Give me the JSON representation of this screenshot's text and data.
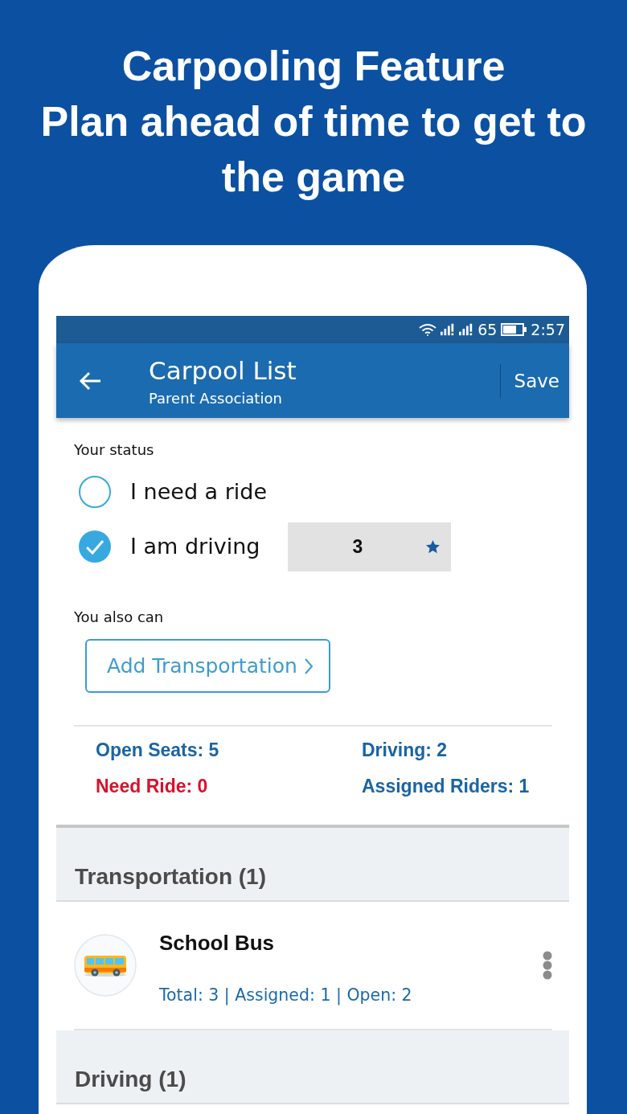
{
  "headline": {
    "title": "Carpooling Feature",
    "subtitle": "Plan ahead of time to get to the game"
  },
  "status_bar": {
    "battery": "65",
    "time": "2:57"
  },
  "app_bar": {
    "title": "Carpool List",
    "subtitle": "Parent Association",
    "action": "Save"
  },
  "your_status": {
    "label": "Your status",
    "options": [
      {
        "label": "I need a ride",
        "selected": false
      },
      {
        "label": "I am driving",
        "selected": true,
        "dropdown": {
          "value": "3"
        }
      }
    ]
  },
  "also": {
    "label": "You also can",
    "button": "Add Transportation"
  },
  "stats": [
    {
      "text": "Open Seats: 5",
      "color": "#1a64a4"
    },
    {
      "text": "Driving: 2",
      "color": "#1a64a4"
    },
    {
      "text": "Need Ride: 0",
      "color": "#d9102b"
    },
    {
      "text": "Assigned Riders: 1",
      "color": "#1a64a4"
    }
  ],
  "sections": [
    {
      "title": "Transportation (1)",
      "items": [
        {
          "name": "School Bus",
          "details": "Total: 3 | Assigned: 1 | Open: 2"
        }
      ]
    },
    {
      "title": "Driving (1)"
    }
  ]
}
